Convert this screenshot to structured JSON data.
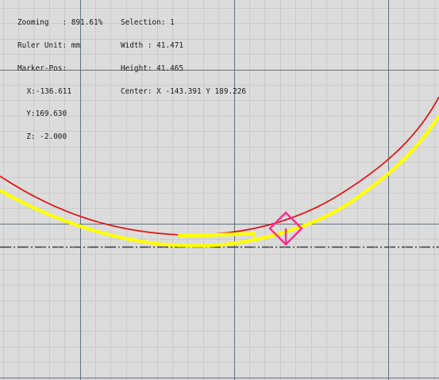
{
  "status": {
    "zooming": "Zooming   : 891.61%",
    "ruler_unit": "Ruler Unit: mm",
    "marker_pos": "Marker-Pos:",
    "x": " X:-136.611",
    "y": "  Y:169.630",
    "z": "  Z: -2.000"
  },
  "selection": {
    "selection": "Selection: 1",
    "width": "Width : 41.471",
    "height": "Height: 41.465",
    "center": "Center: X -143.391 Y 189.226"
  },
  "colors": {
    "background": "#dcdcdc",
    "minor_grid": "#cdcdcd",
    "major_grid": "#5f6f80",
    "red_curve": "#e01818",
    "yellow_curve": "#ffff00",
    "marker": "#ff2a8c",
    "axis": "#3a3a3a"
  }
}
